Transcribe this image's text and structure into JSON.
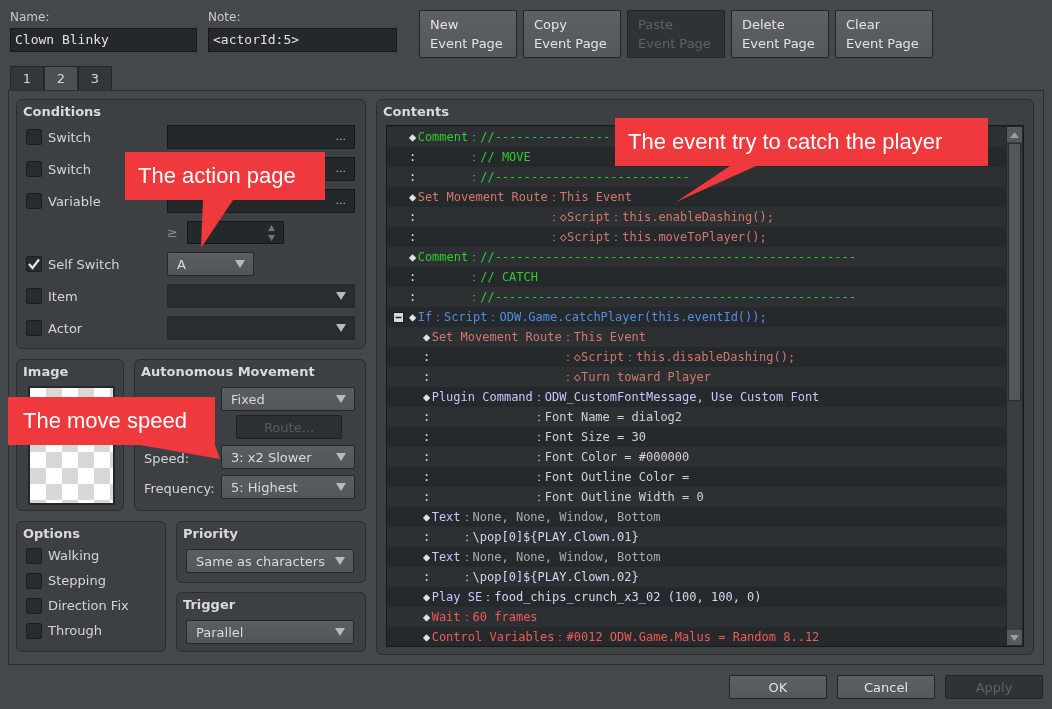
{
  "name": {
    "label": "Name:",
    "value": "Clown Blinky"
  },
  "note": {
    "label": "Note:",
    "value": "<actorId:5>"
  },
  "page_buttons": [
    {
      "label": "New\nEvent Page",
      "disabled": false
    },
    {
      "label": "Copy\nEvent Page",
      "disabled": false
    },
    {
      "label": "Paste\nEvent Page",
      "disabled": true
    },
    {
      "label": "Delete\nEvent Page",
      "disabled": false
    },
    {
      "label": "Clear\nEvent Page",
      "disabled": false
    }
  ],
  "tabs": [
    {
      "label": "1",
      "selected": false
    },
    {
      "label": "2",
      "selected": true
    },
    {
      "label": "3",
      "selected": false
    }
  ],
  "conditions": {
    "title": "Conditions",
    "items": [
      {
        "kind": "picker",
        "label": "Switch",
        "checked": false,
        "button": "..."
      },
      {
        "kind": "picker",
        "label": "Switch",
        "checked": false,
        "button": "..."
      },
      {
        "kind": "picker",
        "label": "Variable",
        "checked": false,
        "button": "..."
      },
      {
        "kind": "spin",
        "symbol": "≥"
      },
      {
        "kind": "short_dropdown",
        "label": "Self Switch",
        "checked": true,
        "value": "A"
      },
      {
        "kind": "dropdown",
        "label": "Item",
        "checked": false
      },
      {
        "kind": "dropdown",
        "label": "Actor",
        "checked": false
      }
    ]
  },
  "image": {
    "title": "Image"
  },
  "movement": {
    "title": "Autonomous Movement",
    "items": [
      {
        "kind": "dropdown",
        "value": "Fixed"
      },
      {
        "kind": "button",
        "label": "Route...",
        "disabled": true
      },
      {
        "kind": "dropdown",
        "label": "Speed:",
        "value": "3: x2 Slower"
      },
      {
        "kind": "dropdown",
        "label": "Frequency:",
        "value": "5: Highest"
      }
    ]
  },
  "options": {
    "title": "Options",
    "items": [
      {
        "label": "Walking",
        "checked": false
      },
      {
        "label": "Stepping",
        "checked": false
      },
      {
        "label": "Direction Fix",
        "checked": false
      },
      {
        "label": "Through",
        "checked": false
      }
    ]
  },
  "priority": {
    "title": "Priority",
    "value": "Same as characters"
  },
  "trigger": {
    "title": "Trigger",
    "value": "Parallel"
  },
  "contents": {
    "title": "Contents",
    "commands": [
      {
        "marker": "◆",
        "label": "Comment",
        "color": "#2ecc2e",
        "params": {
          "text": "：//----------------",
          "color": "#2ecc2e"
        },
        "lines": [
          {
            "marker": ":",
            "value": "：// MOVE",
            "color": "#2ecc2e"
          },
          {
            "marker": ":",
            "value": "：//---------------------------",
            "color": "#2ecc2e"
          }
        ]
      },
      {
        "marker": "◆",
        "label": "Set Movement Route",
        "color": "#d2776c",
        "params": {
          "text": "：This Event",
          "color": "#d2776c"
        },
        "lines": [
          {
            "marker": ":",
            "value": "：◇Script：this.enableDashing();",
            "color": "#d2776c"
          },
          {
            "marker": ":",
            "value": "：◇Script：this.moveToPlayer();",
            "color": "#d2776c"
          }
        ]
      },
      {
        "marker": "◆",
        "label": "Comment",
        "color": "#2ecc2e",
        "params": {
          "text": "：//--------------------------------------------------",
          "color": "#2ecc2e"
        },
        "lines": [
          {
            "marker": ":",
            "value": "：// CATCH",
            "color": "#2ecc2e"
          },
          {
            "marker": ":",
            "value": "：//--------------------------------------------------",
            "color": "#2ecc2e"
          }
        ]
      },
      {
        "marker": "◆",
        "label": "If",
        "color": "#4f8fe6",
        "params": {
          "text": "：Script：ODW.Game.catchPlayer(this.eventId());",
          "color": "#4f8fe6"
        },
        "expanded": true,
        "children": [
          {
            "marker": "◆",
            "label": "Set Movement Route",
            "color": "#d2776c",
            "params": {
              "text": "：This Event",
              "color": "#d2776c"
            },
            "lines": [
              {
                "marker": ":",
                "value": "：◇Script：this.disableDashing();",
                "color": "#d2776c"
              },
              {
                "marker": ":",
                "value": "：◇Turn toward Player",
                "color": "#d2776c"
              }
            ]
          },
          {
            "marker": "◆",
            "label": "Plugin Command",
            "color": "#c4c6ff",
            "params": {
              "text": "：ODW_CustomFontMessage, Use Custom Font",
              "color": "#c4c6ff"
            },
            "lines": [
              {
                "marker": ":",
                "value": "：Font Name = dialog2",
                "color": "#cfd0dc"
              },
              {
                "marker": ":",
                "value": "：Font Size = 30",
                "color": "#cfd0dc"
              },
              {
                "marker": ":",
                "value": "：Font Color = #000000",
                "color": "#cfd0dc"
              },
              {
                "marker": ":",
                "value": "：Font Outline Color =",
                "color": "#cfd0dc"
              },
              {
                "marker": ":",
                "value": "：Font Outline Width = 0",
                "color": "#cfd0dc"
              }
            ]
          },
          {
            "marker": "◆",
            "label": "Text",
            "color": "#c4c6ff",
            "params": {
              "text": "：None, None, Window, Bottom",
              "color": "#a8aaae"
            },
            "lines": [
              {
                "marker": ":",
                "value": "：\\pop[0]${PLAY.Clown.01}",
                "color": "#d4d6f4"
              }
            ]
          },
          {
            "marker": "◆",
            "label": "Text",
            "color": "#c4c6ff",
            "params": {
              "text": "：None, None, Window, Bottom",
              "color": "#a8aaae"
            },
            "lines": [
              {
                "marker": ":",
                "value": "：\\pop[0]${PLAY.Clown.02}",
                "color": "#d4d6f4"
              }
            ]
          },
          {
            "marker": "◆",
            "label": "Play SE",
            "color": "#c4c6ff",
            "params": {
              "text": "：food_chips_crunch_x3_02 (100, 100, 0)",
              "color": "#d4d6f4"
            }
          },
          {
            "marker": "◆",
            "label": "Wait",
            "color": "#ee5a55",
            "params": {
              "text": "：60 frames",
              "color": "#ee5a55"
            }
          },
          {
            "marker": "◆",
            "label": "Control Variables",
            "color": "#ee5a55",
            "params": {
              "text": "：#0012 ODW.Game.Malus = Random 8..12",
              "color": "#ee5a55"
            }
          }
        ]
      }
    ]
  },
  "dialog_buttons": [
    {
      "label": "OK",
      "disabled": false
    },
    {
      "label": "Cancel",
      "disabled": false
    },
    {
      "label": "Apply",
      "disabled": true
    }
  ],
  "callouts": [
    {
      "text": "The event try to catch the player"
    },
    {
      "text": "The action page"
    },
    {
      "text": "The move speed"
    }
  ]
}
